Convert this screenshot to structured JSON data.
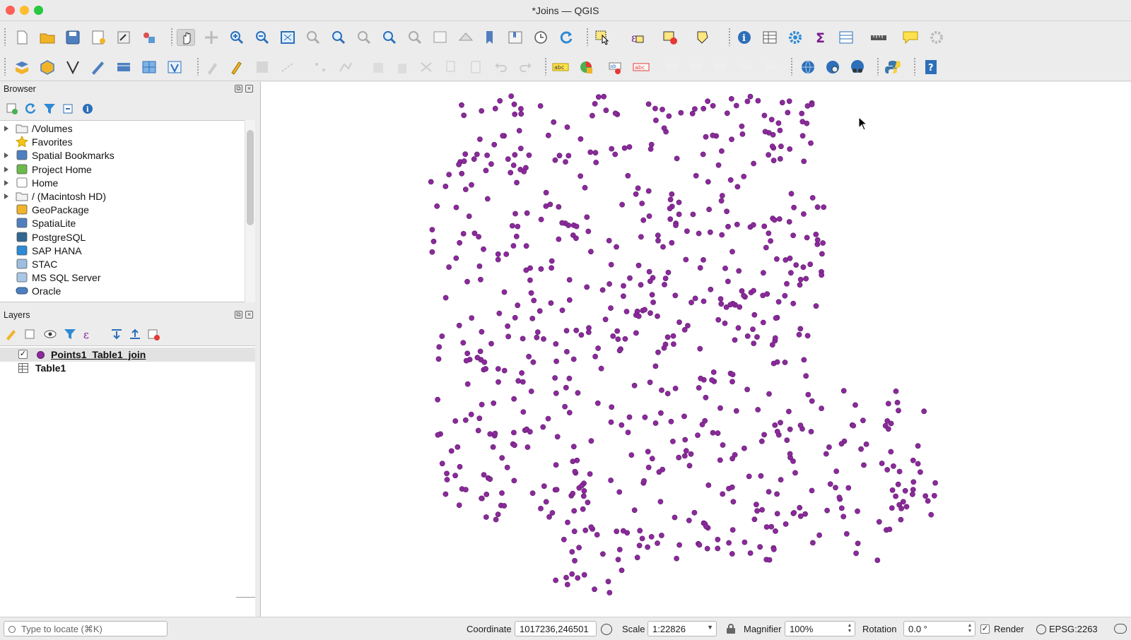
{
  "window": {
    "title": "*Joins — QGIS"
  },
  "browser": {
    "title": "Browser",
    "items": [
      {
        "label": "/Volumes",
        "icon": "folder-icon",
        "expandable": true
      },
      {
        "label": "Favorites",
        "icon": "star-icon",
        "expandable": false
      },
      {
        "label": "Spatial Bookmarks",
        "icon": "bookmark-icon",
        "expandable": true
      },
      {
        "label": "Project Home",
        "icon": "project-home-icon",
        "expandable": true
      },
      {
        "label": "Home",
        "icon": "home-icon",
        "expandable": true
      },
      {
        "label": "/ (Macintosh HD)",
        "icon": "folder-icon",
        "expandable": true
      },
      {
        "label": "GeoPackage",
        "icon": "geopackage-icon",
        "expandable": false
      },
      {
        "label": "SpatiaLite",
        "icon": "spatialite-icon",
        "expandable": false
      },
      {
        "label": "PostgreSQL",
        "icon": "postgresql-icon",
        "expandable": false
      },
      {
        "label": "SAP HANA",
        "icon": "sap-hana-icon",
        "expandable": false
      },
      {
        "label": "STAC",
        "icon": "stac-icon",
        "expandable": false
      },
      {
        "label": "MS SQL Server",
        "icon": "mssql-icon",
        "expandable": false
      },
      {
        "label": "Oracle",
        "icon": "oracle-icon",
        "expandable": false
      }
    ]
  },
  "layers": {
    "title": "Layers",
    "items": [
      {
        "label": "Points1_Table1_join",
        "checked": true,
        "icon": "point-layer-icon",
        "active": true
      },
      {
        "label": "Table1",
        "checked": false,
        "icon": "table-layer-icon",
        "active": false
      }
    ]
  },
  "map": {
    "point_color": "#8b2a9b",
    "point_stroke": "#5e1b6c",
    "background": "#ffffff"
  },
  "statusbar": {
    "locator_placeholder": "Type to locate (⌘K)",
    "coordinate_label": "Coordinate",
    "coordinate_value": "1017236,246501",
    "scale_label": "Scale",
    "scale_value": "1:22826",
    "magnifier_label": "Magnifier",
    "magnifier_value": "100%",
    "rotation_label": "Rotation",
    "rotation_value": "0.0 °",
    "render_label": "Render",
    "render_checked": true,
    "crs": "EPSG:2263"
  }
}
